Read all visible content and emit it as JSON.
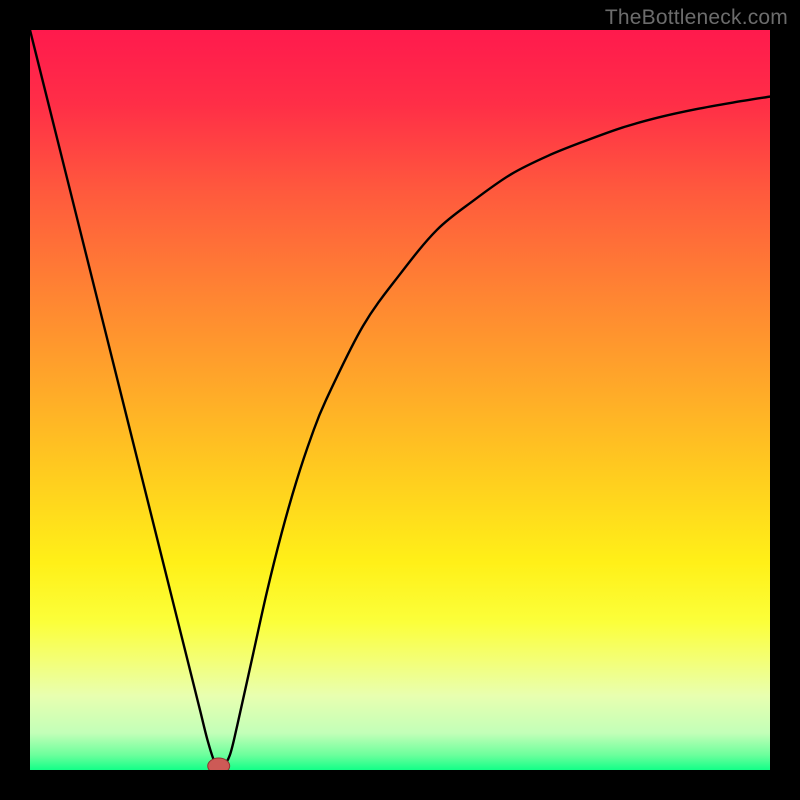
{
  "watermark": "TheBottleneck.com",
  "chart_data": {
    "type": "line",
    "title": "",
    "xlabel": "",
    "ylabel": "",
    "xlim": [
      0,
      100
    ],
    "ylim": [
      0,
      100
    ],
    "x": [
      0,
      5,
      10,
      12,
      15,
      18,
      20,
      22,
      23,
      24,
      25,
      26,
      27,
      28,
      30,
      32,
      34,
      36,
      38,
      40,
      45,
      50,
      55,
      60,
      65,
      70,
      75,
      80,
      85,
      90,
      95,
      100
    ],
    "values": [
      100,
      80,
      60,
      52,
      40,
      28,
      20,
      12,
      8,
      4,
      1,
      0.5,
      2,
      6,
      15,
      24,
      32,
      39,
      45,
      50,
      60,
      67,
      73,
      77,
      80.5,
      83,
      85,
      86.8,
      88.2,
      89.3,
      90.2,
      91
    ],
    "marker": {
      "x": 25.5,
      "y": 0
    },
    "gradient_stops": [
      {
        "offset": 0.0,
        "color": "#ff1a4d"
      },
      {
        "offset": 0.1,
        "color": "#ff2e47"
      },
      {
        "offset": 0.22,
        "color": "#ff5a3d"
      },
      {
        "offset": 0.35,
        "color": "#ff8233"
      },
      {
        "offset": 0.48,
        "color": "#ffa829"
      },
      {
        "offset": 0.6,
        "color": "#ffcc1f"
      },
      {
        "offset": 0.72,
        "color": "#fff018"
      },
      {
        "offset": 0.8,
        "color": "#fbff3a"
      },
      {
        "offset": 0.85,
        "color": "#f4ff74"
      },
      {
        "offset": 0.9,
        "color": "#e8ffb0"
      },
      {
        "offset": 0.95,
        "color": "#c3ffb8"
      },
      {
        "offset": 0.98,
        "color": "#6bff9c"
      },
      {
        "offset": 1.0,
        "color": "#13ff88"
      }
    ]
  }
}
